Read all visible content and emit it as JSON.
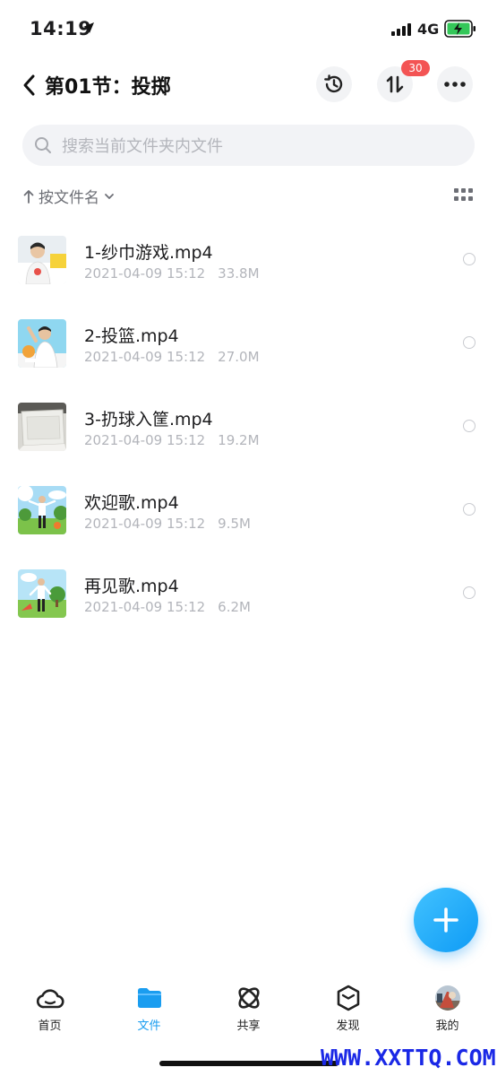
{
  "status_bar": {
    "time": "14:19",
    "network": "4G"
  },
  "header": {
    "title": "第01节：投掷",
    "transfer_badge": "30"
  },
  "search": {
    "placeholder": "搜索当前文件夹内文件"
  },
  "sort": {
    "label": "按文件名"
  },
  "files": [
    {
      "name": "1-纱巾游戏.mp4",
      "date": "2021-04-09 15:12",
      "size": "33.8M",
      "thumb": "person-portrait"
    },
    {
      "name": "2-投篮.mp4",
      "date": "2021-04-09 15:12",
      "size": "27.0M",
      "thumb": "person-basket"
    },
    {
      "name": "3-扔球入筐.mp4",
      "date": "2021-04-09 15:12",
      "size": "19.2M",
      "thumb": "plastic-box"
    },
    {
      "name": "欢迎歌.mp4",
      "date": "2021-04-09 15:12",
      "size": "9.5M",
      "thumb": "cartoon-field"
    },
    {
      "name": "再见歌.mp4",
      "date": "2021-04-09 15:12",
      "size": "6.2M",
      "thumb": "cartoon-field"
    }
  ],
  "tabbar": {
    "items": [
      {
        "label": "首页",
        "icon": "cloud-icon"
      },
      {
        "label": "文件",
        "icon": "folder-icon",
        "active": true
      },
      {
        "label": "共享",
        "icon": "orbit-icon"
      },
      {
        "label": "发现",
        "icon": "cube-icon"
      },
      {
        "label": "我的",
        "icon": "avatar"
      }
    ]
  },
  "watermark": "WWW.XXTTQ.COM",
  "colors": {
    "accent": "#1a9df0",
    "badge": "#f35454",
    "battery": "#34c759"
  }
}
